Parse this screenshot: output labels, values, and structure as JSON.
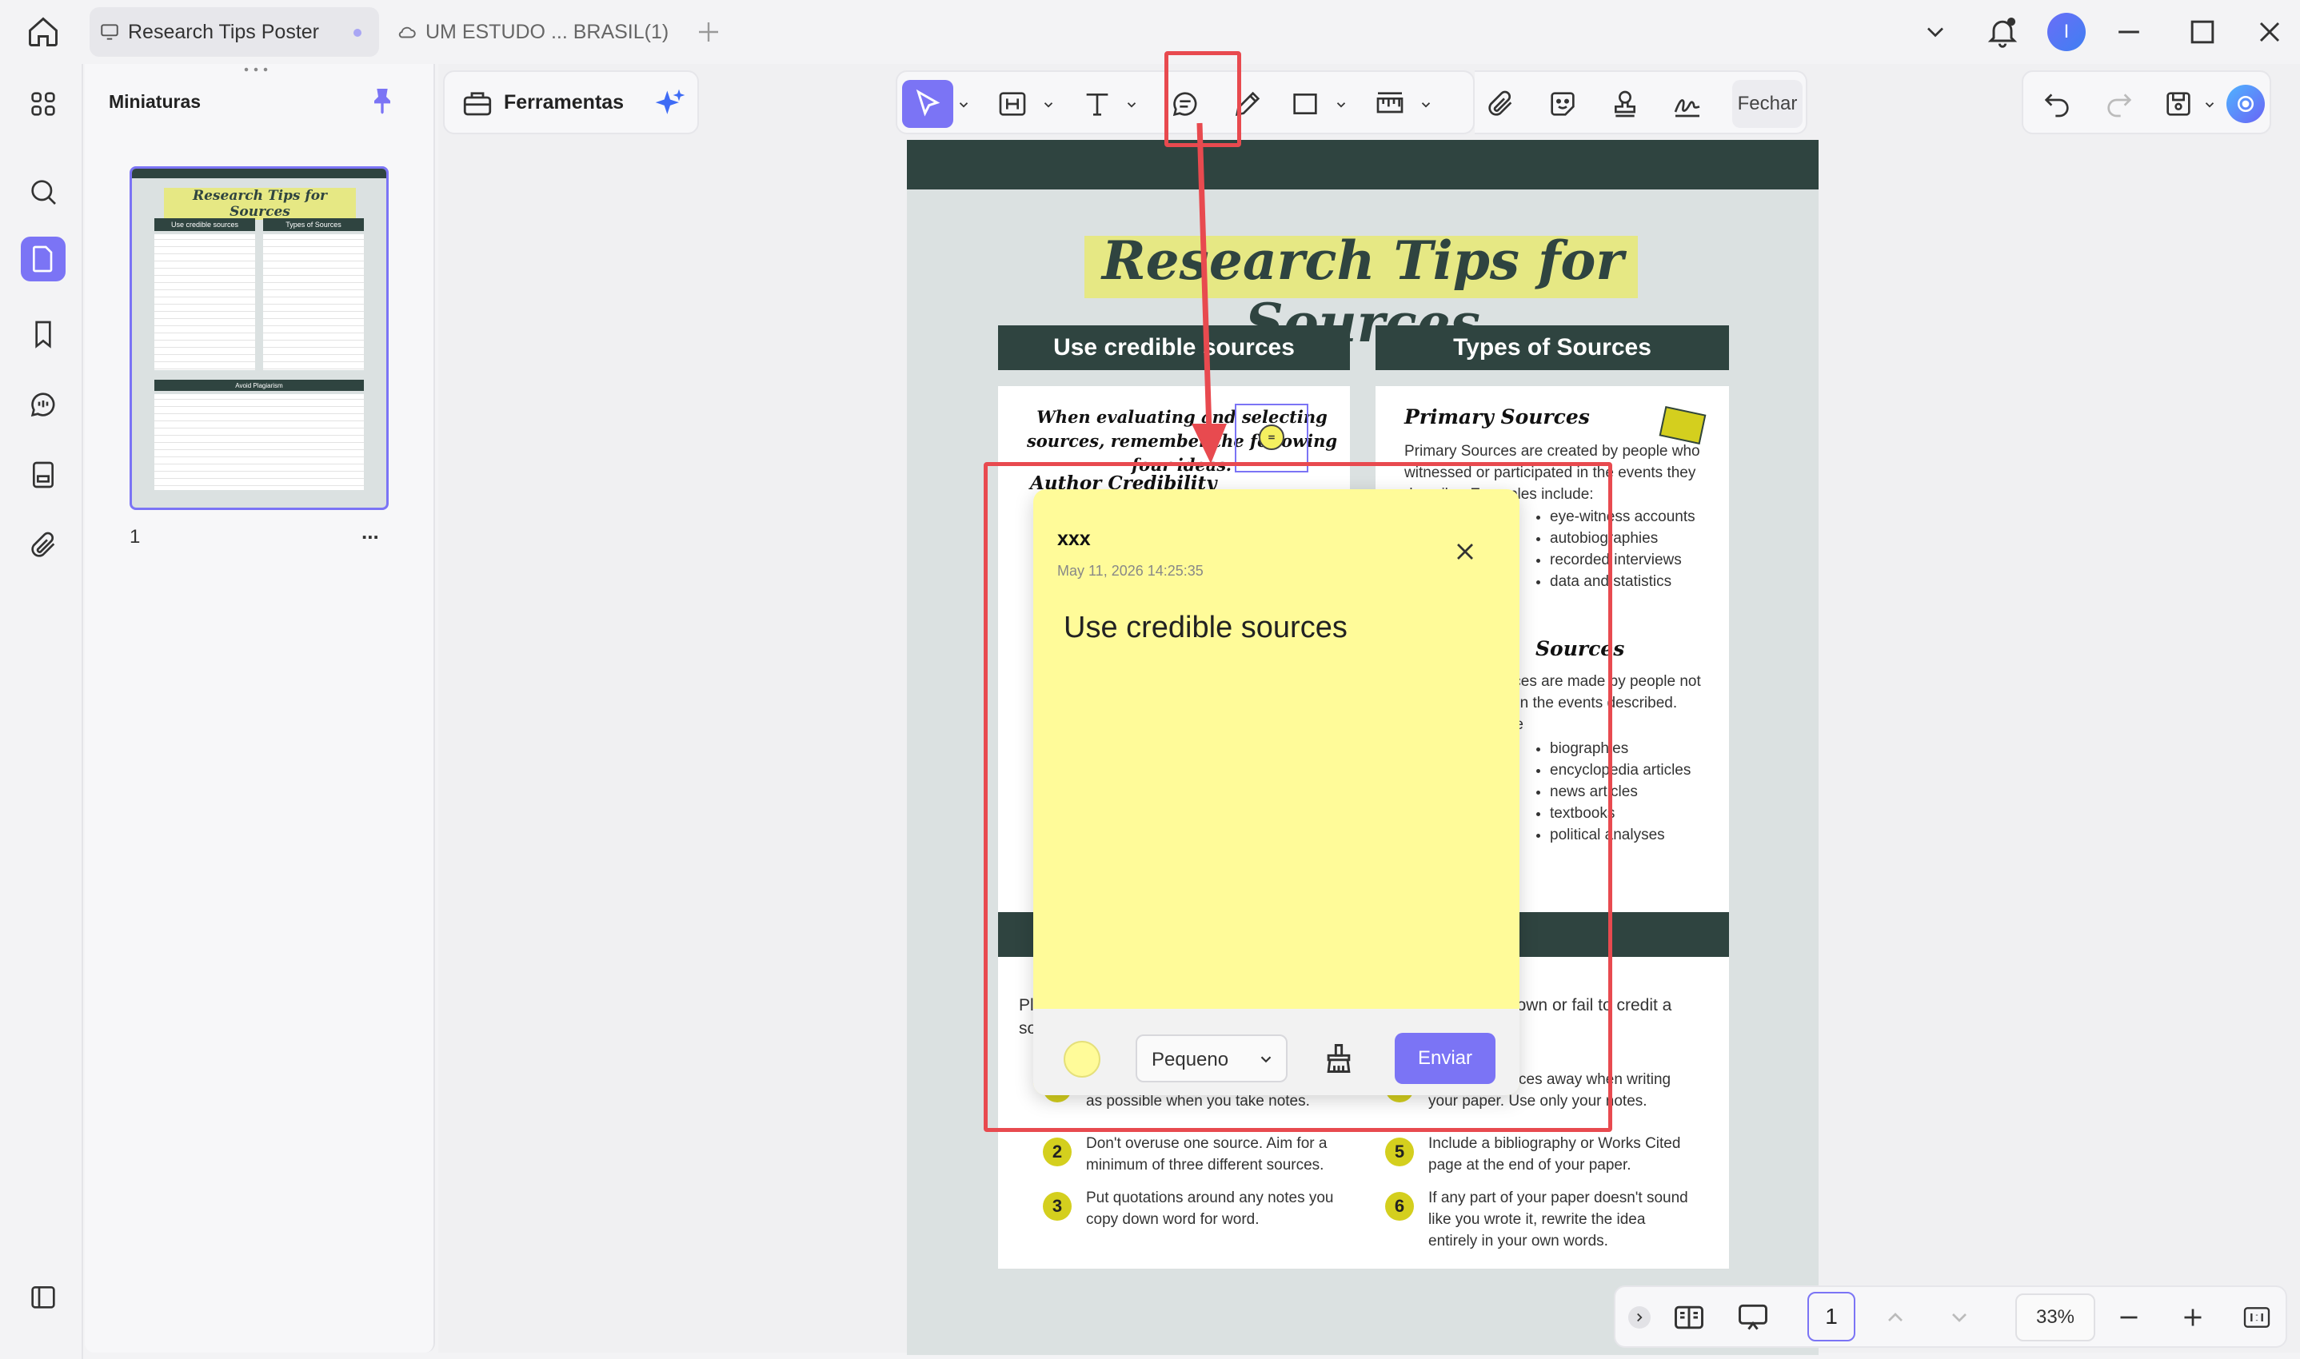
{
  "tabs": [
    {
      "label": "Research Tips Poster",
      "active": true
    },
    {
      "label": "UM ESTUDO ... BRASIL(1)",
      "active": false
    }
  ],
  "user_initial": "I",
  "thumbnails_panel": {
    "title": "Miniaturas",
    "page_number": "1",
    "more": "..."
  },
  "thumbnail": {
    "title": "Research Tips for Sources",
    "left_header": "Use credible sources",
    "right_header": "Types of Sources",
    "bottom_header": "Avoid Plagiarism"
  },
  "toolbar": {
    "tools_label": "Ferramentas",
    "close_label": "Fechar"
  },
  "document": {
    "title": "Research Tips for Sources",
    "left_header": "Use credible sources",
    "right_header": "Types of Sources",
    "left_intro": "When evaluating and selecting sources, remember the following four ideas:",
    "left_sub1": "Author Credibility",
    "primary_heading": "Primary Sources",
    "primary_text": "Primary Sources are created by people who witnessed or participated in the events they describe. Examples include:",
    "primary_items": [
      "eye-witness accounts",
      "autobiographies",
      "recorded interviews",
      "data and statistics"
    ],
    "secondary_heading_tail": "Sources",
    "secondary_text": "Secondary Sources are made by people not directly involved in the events described. Examples include",
    "secondary_items": [
      "biographies",
      "encyclopedia articles",
      "news articles",
      "textbooks",
      "political analyses"
    ],
    "plag_text": "Plagiarism occurs when writers use someone else's words as their own or fail to credit a source correctly.",
    "tips": [
      {
        "n": "1",
        "text": "Summarize and paraphrase as much as possible when you take notes."
      },
      {
        "n": "2",
        "text": "Don't overuse one source. Aim for a minimum of three different sources."
      },
      {
        "n": "3",
        "text": "Put quotations around any notes you copy down word for word."
      },
      {
        "n": "4",
        "text": "Put your sources away when writing your paper. Use only your notes."
      },
      {
        "n": "5",
        "text": "Include a bibliography or Works Cited page at the end of your paper."
      },
      {
        "n": "6",
        "text": "If any part of your paper doesn't sound like you wrote it, rewrite the idea entirely in your own words."
      }
    ]
  },
  "note": {
    "author": "xxx",
    "timestamp": "May 11, 2026 14:25:35",
    "content": "Use credible sources",
    "size_select": "Pequeno",
    "send_label": "Enviar",
    "color": "#fffb99"
  },
  "bottom": {
    "page_input": "1",
    "zoom": "33%"
  },
  "colors": {
    "accent": "#7b74f5",
    "highlight_red": "#e84a4f",
    "poster_dark": "#2f4440",
    "poster_bg": "#dbe1e1",
    "poster_yellow": "#d4cf1e"
  }
}
